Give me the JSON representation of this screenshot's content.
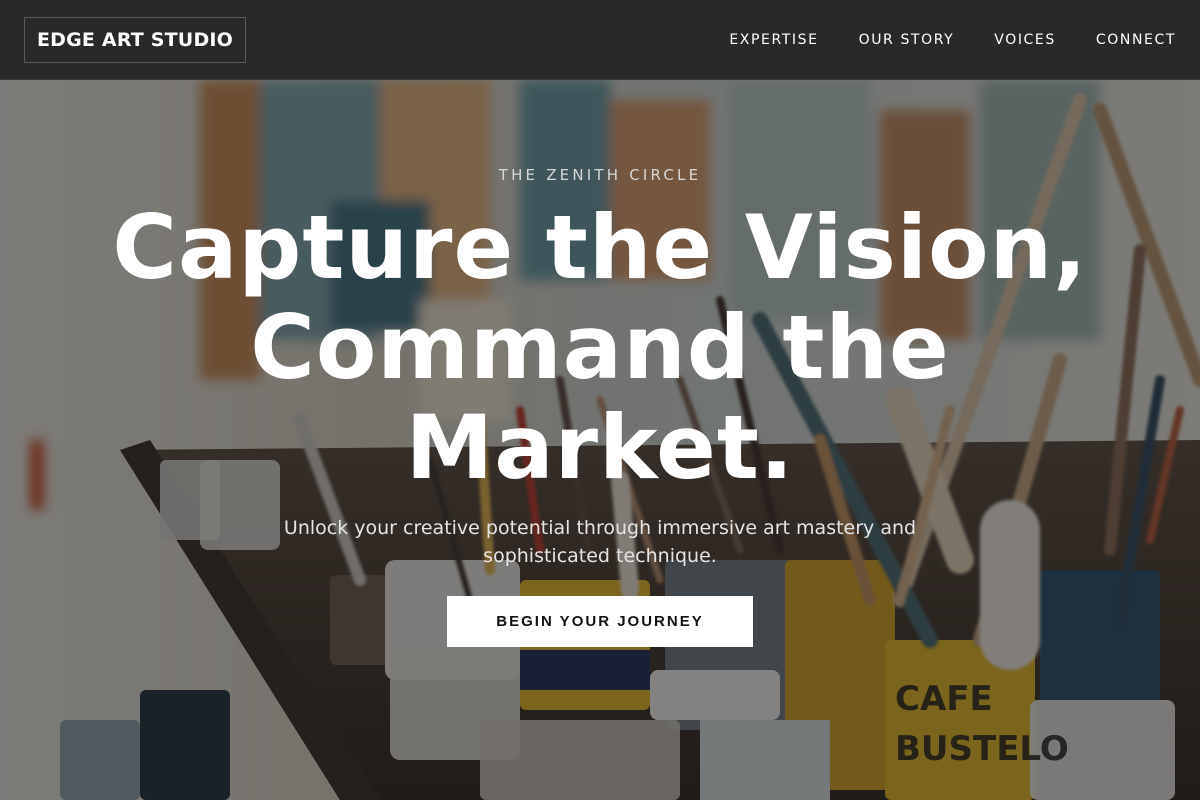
{
  "navbar": {
    "logo_text": "EDGE ART STUDIO",
    "links": [
      {
        "label": "EXPERTISE"
      },
      {
        "label": "OUR STORY"
      },
      {
        "label": "VOICES"
      },
      {
        "label": "CONNECT"
      }
    ]
  },
  "hero": {
    "eyebrow": "THE ZENITH CIRCLE",
    "headline_line1": "Capture the Vision,",
    "headline_line2": "Command the",
    "headline_line3": "Market.",
    "subtitle_line1": "Unlock your creative potential through immersive art mastery and",
    "subtitle_line2": "sophisticated technique.",
    "cta_label": "BEGIN YOUR JOURNEY",
    "background_image": "art-studio-paint-brushes-photo"
  },
  "colors": {
    "navbar_bg": "#292929",
    "text_primary": "#ffffff",
    "cta_bg": "#ffffff",
    "cta_text": "#111111",
    "overlay": "rgba(18,18,18,0.5)"
  }
}
